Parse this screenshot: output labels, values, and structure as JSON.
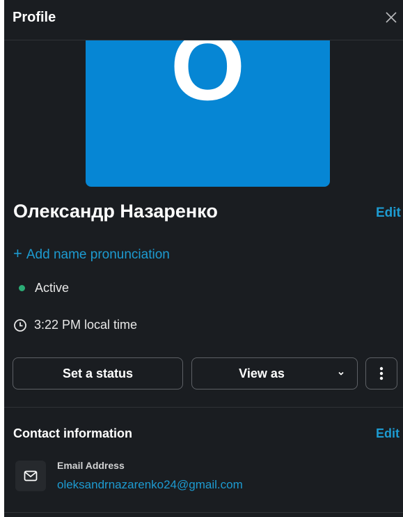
{
  "header": {
    "title": "Profile",
    "close_icon": "close-icon"
  },
  "avatar": {
    "letter": "O",
    "color": "#0686d4"
  },
  "profile": {
    "name": "Олександр Назаренко",
    "edit_label": "Edit",
    "pronunciation_label": "Add name pronunciation",
    "pronunciation_icon": "+",
    "status": "Active",
    "status_color": "#2bac76",
    "local_time": "3:22 PM local time"
  },
  "actions": {
    "set_status_label": "Set a status",
    "view_as_label": "View as",
    "more_icon": "vertical-ellipsis-icon"
  },
  "contact": {
    "section_title": "Contact information",
    "edit_label": "Edit",
    "email_label": "Email Address",
    "email_value": "oleksandrnazarenko24@gmail.com"
  },
  "theme": {
    "background": "#1a1d21",
    "link": "#1d9bd1",
    "text": "#ffffff"
  }
}
